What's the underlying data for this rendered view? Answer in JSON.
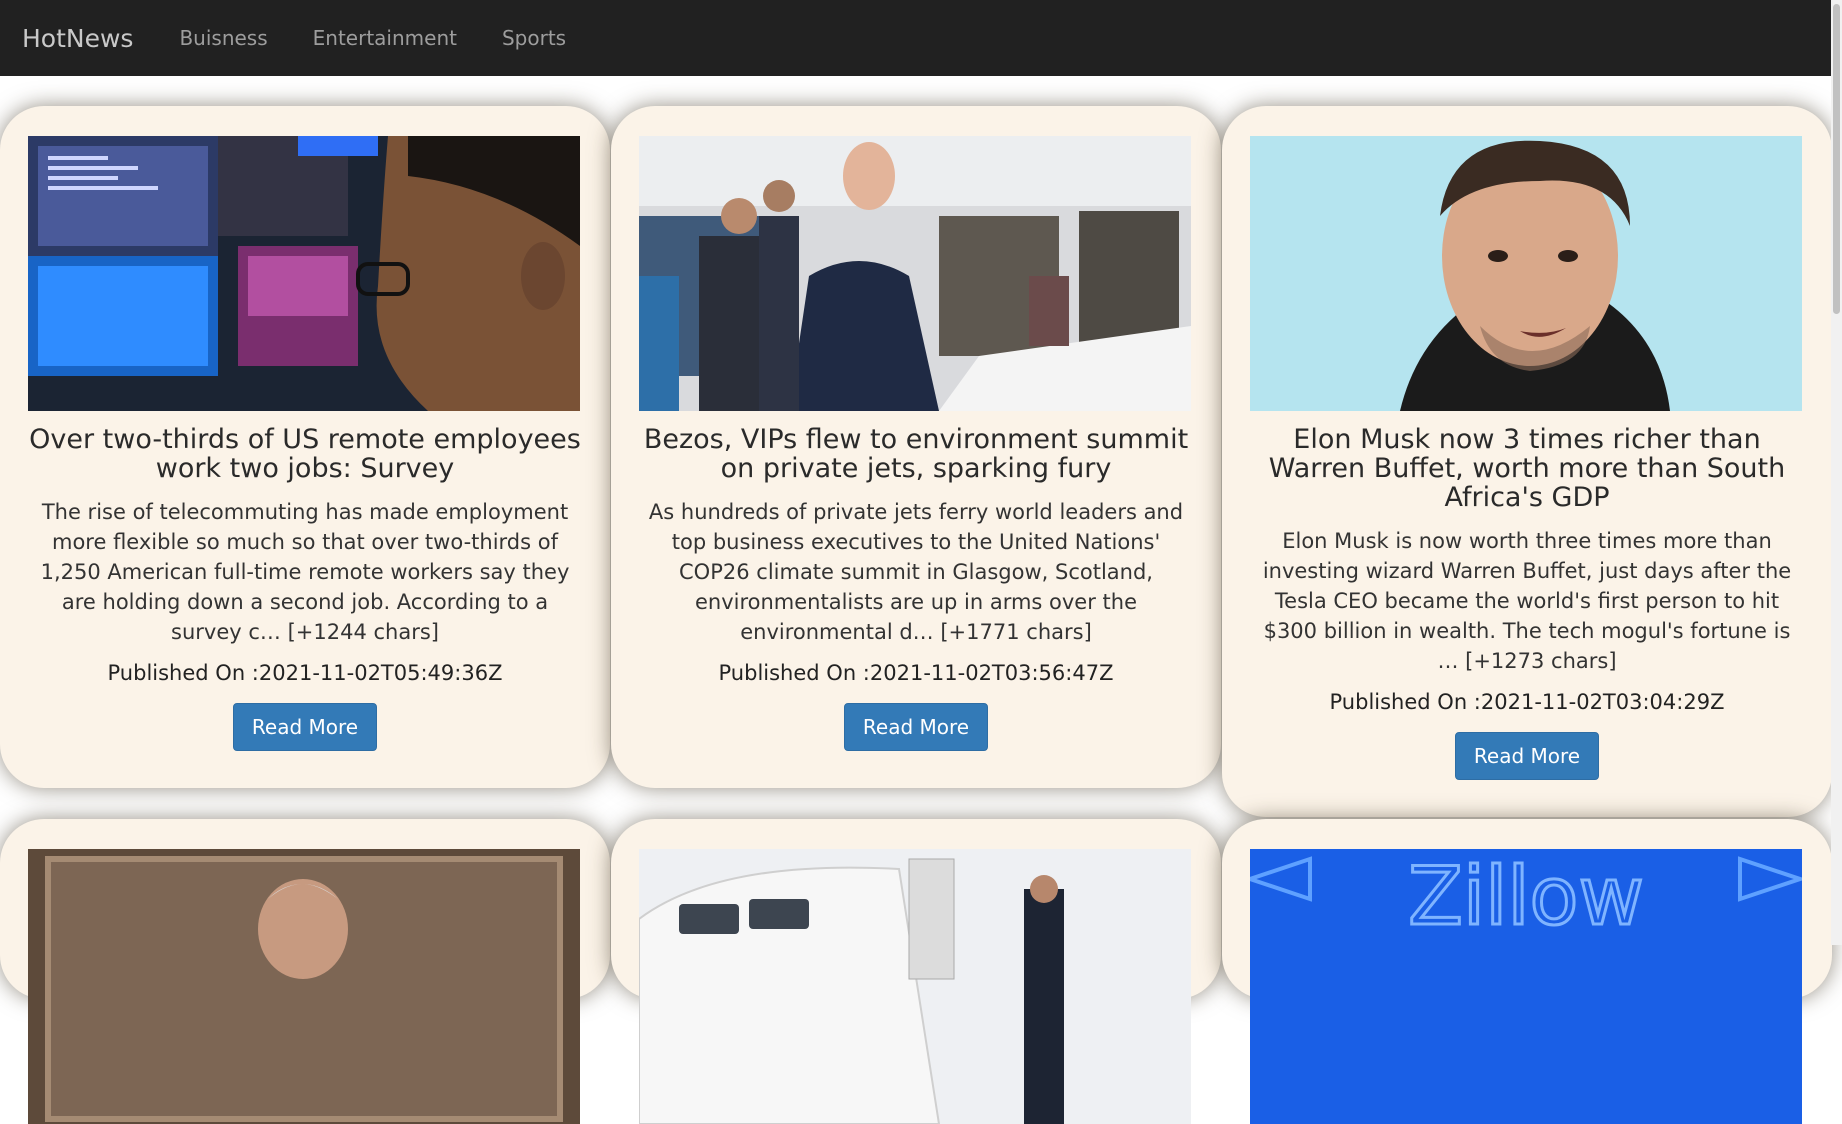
{
  "navbar": {
    "brand": "HotNews",
    "links": [
      "Buisness",
      "Entertainment",
      "Sports"
    ]
  },
  "articles": [
    {
      "title": "Over two-thirds of US remote employees work two jobs: Survey",
      "description": "The rise of telecommuting has made employment more flexible so much so that over two-thirds of 1,250 American full-time remote workers say they are holding down a second job. According to a survey c… [+1244 chars]",
      "published": "Published On :2021-11-02T05:49:36Z",
      "button": "Read More"
    },
    {
      "title": "Bezos, VIPs flew to environment summit on private jets, sparking fury",
      "description": "As hundreds of private jets ferry world leaders and top business executives to the United Nations' COP26 climate summit in Glasgow, Scotland, environmentalists are up in arms over the environmental d… [+1771 chars]",
      "published": "Published On :2021-11-02T03:56:47Z",
      "button": "Read More"
    },
    {
      "title": "Elon Musk now 3 times richer than Warren Buffet, worth more than South Africa's GDP",
      "description": "Elon Musk is now worth three times more than investing wizard Warren Buffet, just days after the Tesla CEO became the world's first person to hit $300 billion in wealth. The tech mogul's fortune is … [+1273 chars]",
      "published": "Published On :2021-11-02T03:04:29Z",
      "button": "Read More"
    }
  ],
  "partial_cards": {
    "third_image_text": "Zillow"
  },
  "colors": {
    "navbar_bg": "#212121",
    "card_bg": "#fbf3e8",
    "button_bg": "#337ab7"
  }
}
